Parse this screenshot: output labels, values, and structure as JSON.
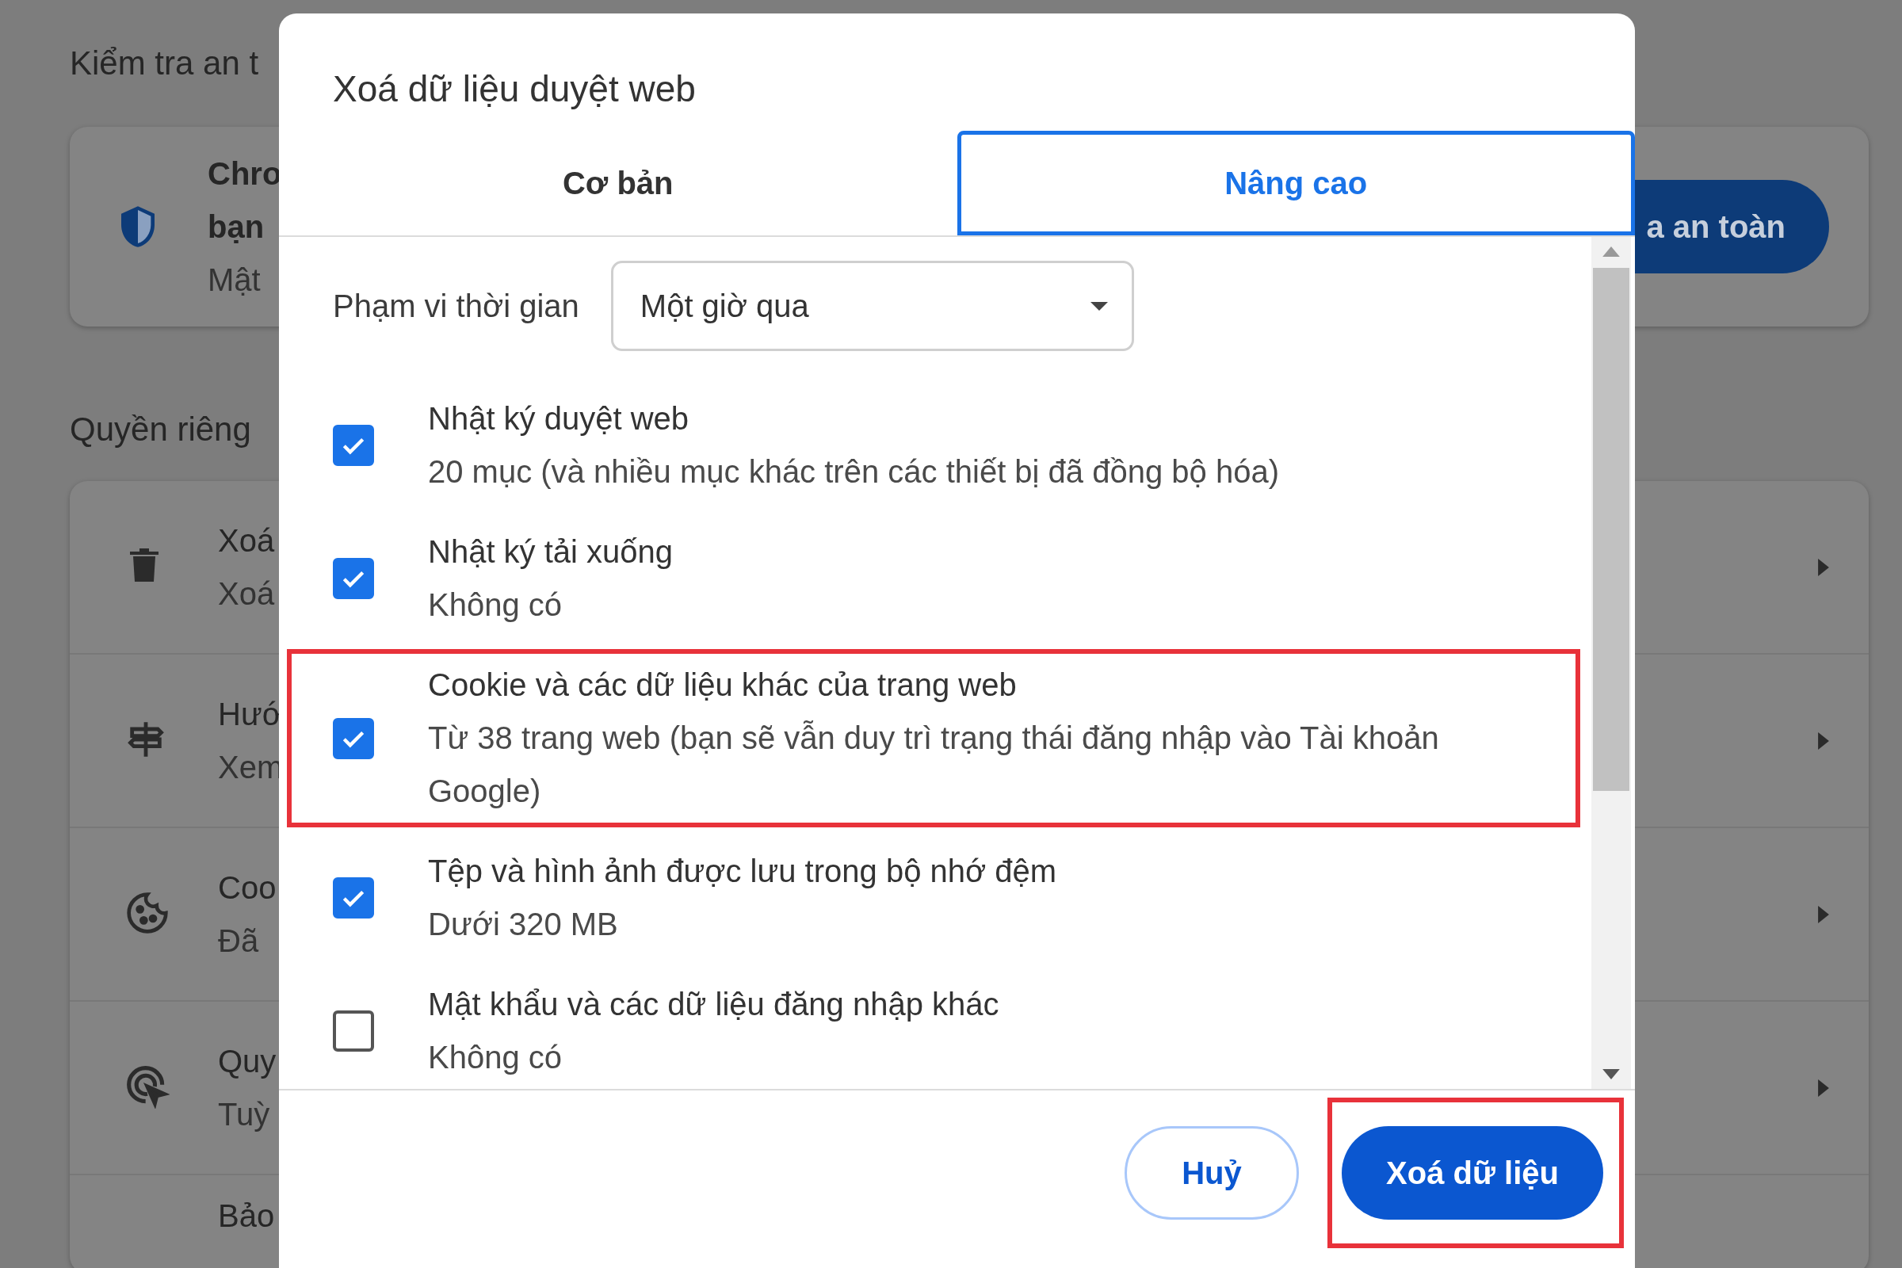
{
  "background": {
    "safety_heading": "Kiểm tra an t",
    "safety_card": {
      "lines": [
        "Chro",
        "bạn",
        "Mật"
      ],
      "button": "a an toàn"
    },
    "privacy_heading": "Quyền riêng",
    "privacy_rows": [
      {
        "kind": "trash",
        "title": "Xoá",
        "subtitle": "Xoá"
      },
      {
        "kind": "signpost",
        "title": "Hướ",
        "subtitle": "Xem"
      },
      {
        "kind": "cookie",
        "title": "Coo",
        "subtitle": "Đã"
      },
      {
        "kind": "cursor",
        "title": "Quy",
        "subtitle": "Tuỳ"
      },
      {
        "kind": "partial",
        "title": "Bảo"
      }
    ]
  },
  "dialog": {
    "title": "Xoá dữ liệu duyệt web",
    "tabs": [
      {
        "label": "Cơ bản",
        "selected": false
      },
      {
        "label": "Nâng cao",
        "selected": true
      }
    ],
    "time_range": {
      "label": "Phạm vi thời gian",
      "value": "Một giờ qua"
    },
    "items": [
      {
        "title": "Nhật ký duyệt web",
        "detail": "20 mục (và nhiều mục khác trên các thiết bị đã đồng bộ hóa)",
        "checked": true,
        "highlighted": false
      },
      {
        "title": "Nhật ký tải xuống",
        "detail": "Không có",
        "checked": true,
        "highlighted": false
      },
      {
        "title": "Cookie và các dữ liệu khác của trang web",
        "detail": "Từ 38 trang web (bạn sẽ vẫn duy trì trạng thái đăng nhập vào Tài khoản Google)",
        "checked": true,
        "highlighted": true
      },
      {
        "title": "Tệp và hình ảnh được lưu trong bộ nhớ đệm",
        "detail": "Dưới 320 MB",
        "checked": true,
        "highlighted": false
      },
      {
        "title": "Mật khẩu và các dữ liệu đăng nhập khác",
        "detail": "Không có",
        "checked": false,
        "highlighted": false
      }
    ],
    "buttons": [
      {
        "kind": "outline",
        "label": "Huỷ",
        "highlighted": false
      },
      {
        "kind": "primary",
        "label": "Xoá dữ liệu",
        "highlighted": true
      }
    ]
  }
}
